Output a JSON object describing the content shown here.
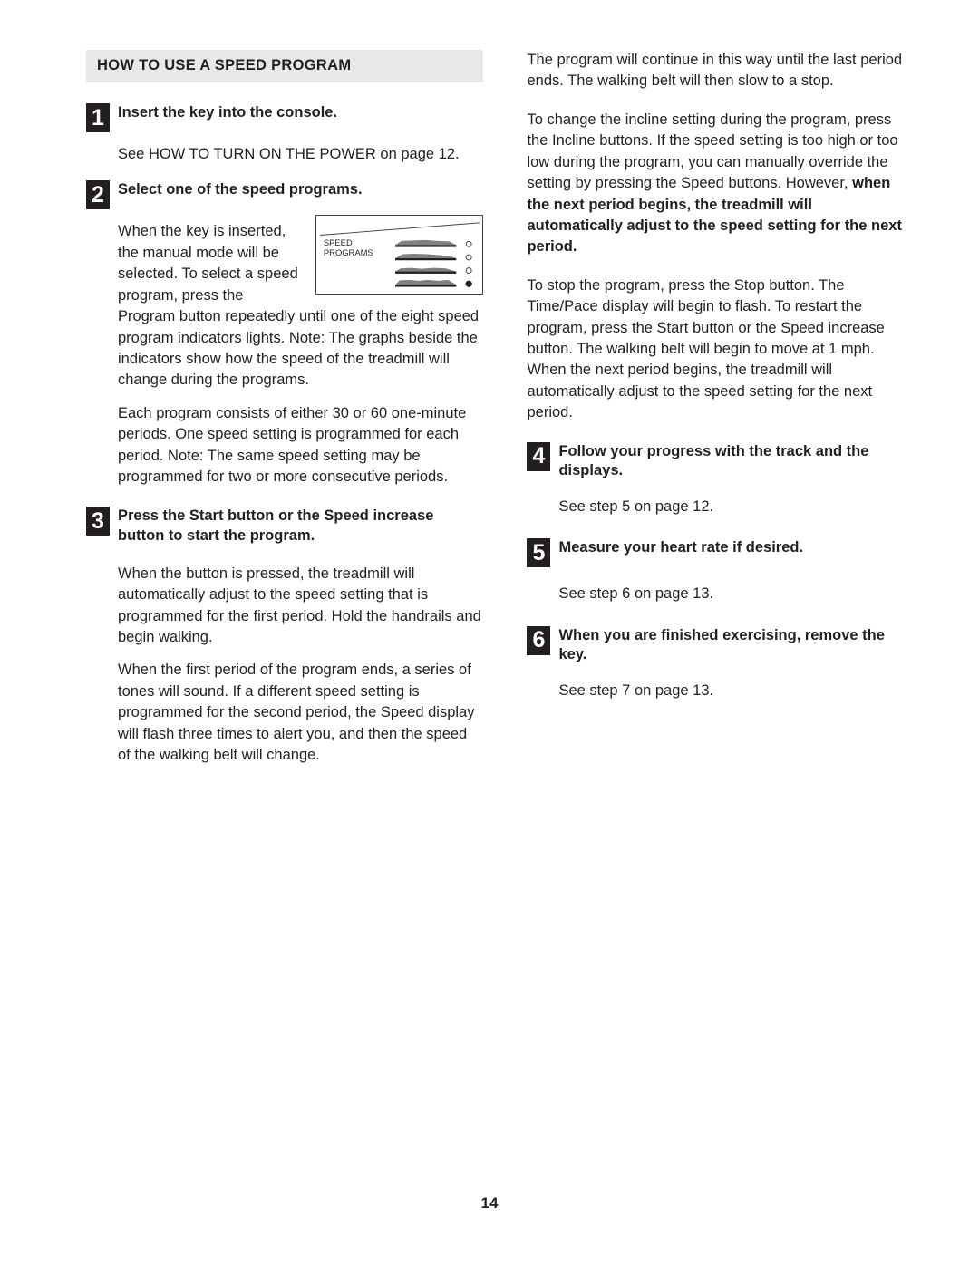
{
  "document": {
    "page_number": "14",
    "section_heading": "HOW TO USE A SPEED PROGRAM"
  },
  "left_column": {
    "step1": {
      "number": "1",
      "title": "Insert the key into the console.",
      "body": "See HOW TO TURN ON THE POWER on page 12."
    },
    "step2": {
      "number": "2",
      "title": "Select one of the speed programs.",
      "body1": "When the key is inserted, the manual mode will be selected. To select a speed program, press the Program button repeatedly until one of the eight speed program indicators lights. Note: The graphs beside the indicators show how the speed of the treadmill will change during the programs.",
      "body2": "Each program consists of either 30 or 60 one-minute periods. One speed setting is programmed for each period. Note: The same speed setting may be programmed for two or more consecutive periods."
    },
    "step3": {
      "number": "3",
      "title": "Press the Start button or the Speed increase button to start the program.",
      "body1": "When the button is pressed, the treadmill will automatically adjust to the speed setting that is programmed for the first period. Hold the handrails and begin walking.",
      "body2": "When the first period of the program ends, a series of tones will sound. If a different speed setting is programmed for the second period, the Speed display will flash three times to alert you, and then the speed of the walking belt will change."
    }
  },
  "diagram": {
    "label_line1": "SPEED",
    "label_line2": "PROGRAMS",
    "indicators": [
      {
        "filled": false
      },
      {
        "filled": false
      },
      {
        "filled": false
      },
      {
        "filled": true
      }
    ]
  },
  "right_column": {
    "para1": "The program will continue in this way until the last period ends. The walking belt will then slow to a stop.",
    "para2_normal_a": "To change the incline setting during the program, press the Incline buttons. If the speed setting is too high or too low during the program, you can manually override the setting by pressing the Speed buttons. However, ",
    "para2_bold": "when the next period begins, the treadmill will automatically adjust to the speed setting for the next period.",
    "para3": "To stop the program, press the Stop button. The Time/Pace display will begin to flash. To restart the program, press the Start button or the Speed increase button. The walking belt will begin to move at 1 mph. When the next period begins, the treadmill will automatically adjust to the speed setting for the next period.",
    "step4": {
      "number": "4",
      "title": "Follow your progress with the track and the displays.",
      "body": "See step 5 on page 12."
    },
    "step5": {
      "number": "5",
      "title": "Measure your heart rate if desired.",
      "body": "See step 6 on page 13."
    },
    "step6": {
      "number": "6",
      "title": "When you are finished exercising, remove the key.",
      "body": "See step 7 on page 13."
    }
  }
}
